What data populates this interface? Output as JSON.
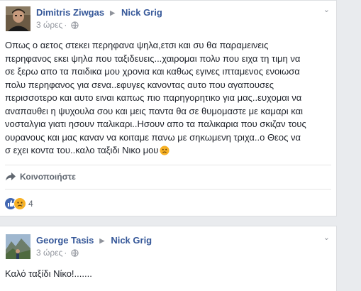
{
  "post1": {
    "author": "Dimitris Ziwgas",
    "target": "Nick Grig",
    "time": "3 ώρες",
    "dot": "·",
    "lines": [
      "Οπως ο αετος στεκει περηφανα ψηλα,ετσι και συ θα παραμεινεις",
      "περηφανος εκει ψηλα που ταξιδευεις...χαιρομαι πολυ που ειχα τη τιμη να",
      "σε ξερω απο τα παιδικα μου χρονια και καθως εγινες ιπταμενος ενοιωσα",
      "πολυ περηφανος για σενα..εφυγες κανοντας αυτο που αγαπουσες",
      "περισσοτερο και αυτο ειναι καπως πιο παρηγορητικο για μας..ευχομαι να",
      "αναπαυθει η ψυχουλα σου και μεις παντα θα σε θυμομαστε με καμαρι και",
      "νοσταλγια γιατι ησουν παλικαρι..Ησουν απο τα παλικαρια που σκιζαν τους",
      "ουρανους και μας καναν να κοιταμε πανω με σηκωμενη τριχα..ο Θεος να",
      "σ εχει κοντα του..καλο ταξιδι Νικο μου"
    ],
    "share_label": "Κοινοποιήστε",
    "reaction_count": "4"
  },
  "post2": {
    "author": "George Tasis",
    "target": "Nick Grig",
    "time": "3 ώρες",
    "dot": "·",
    "text": "Καλό ταξίδι Νίκο!......."
  },
  "icons": {
    "triangle": "▶",
    "chevron": "⌄"
  },
  "colors": {
    "link": "#365899",
    "meta": "#90949c",
    "like": "#4267b2",
    "sad": "#f7b125"
  }
}
